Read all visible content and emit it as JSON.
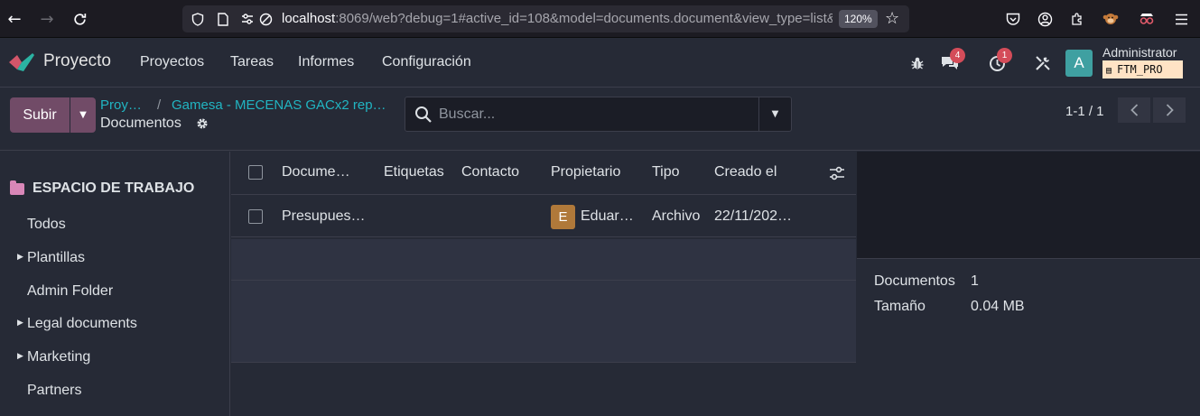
{
  "browser": {
    "url_host": "localhost",
    "url_rest": ":8069/web?debug=1#active_id=108&model=documents.document&view_type=list&",
    "zoom": "120%"
  },
  "navbar": {
    "app_name": "Proyecto",
    "menu": [
      "Proyectos",
      "Tareas",
      "Informes",
      "Configuración"
    ],
    "messages_count": "4",
    "activities_count": "1",
    "avatar_letter": "A",
    "user_name": "Administrator",
    "database": "FTM_PRO"
  },
  "control_panel": {
    "upload_label": "Subir",
    "breadcrumb_root": "Proy…",
    "breadcrumb_sep": "/",
    "breadcrumb_parent": "Gamesa - MECENAS GACx2 rep…",
    "breadcrumb_current": "Documentos",
    "search_placeholder": "Buscar...",
    "pager": "1-1 / 1"
  },
  "sidebar": {
    "header": "ESPACIO DE TRABAJO",
    "items": [
      {
        "label": "Todos",
        "caret": false
      },
      {
        "label": "Plantillas",
        "caret": true
      },
      {
        "label": "Admin Folder",
        "caret": false
      },
      {
        "label": "Legal documents",
        "caret": true
      },
      {
        "label": "Marketing",
        "caret": true
      },
      {
        "label": "Partners",
        "caret": false
      }
    ]
  },
  "list": {
    "columns": [
      "Docume…",
      "Etiquetas",
      "Contacto",
      "Propietario",
      "Tipo",
      "Creado el"
    ],
    "rows": [
      {
        "document": "Presupues…",
        "tags": "",
        "contact": "",
        "owner_initial": "E",
        "owner": "Eduar…",
        "type": "Archivo",
        "created": "22/11/202…"
      }
    ]
  },
  "inspector": {
    "documents_label": "Documentos",
    "documents_value": "1",
    "size_label": "Tamaño",
    "size_value": "0.04 MB"
  },
  "colors": {
    "brand": "#714b67",
    "link": "#21b5c2",
    "badge": "#d44c59",
    "owner_avatar": "#b0793a",
    "user_avatar": "#3fa0a1"
  }
}
